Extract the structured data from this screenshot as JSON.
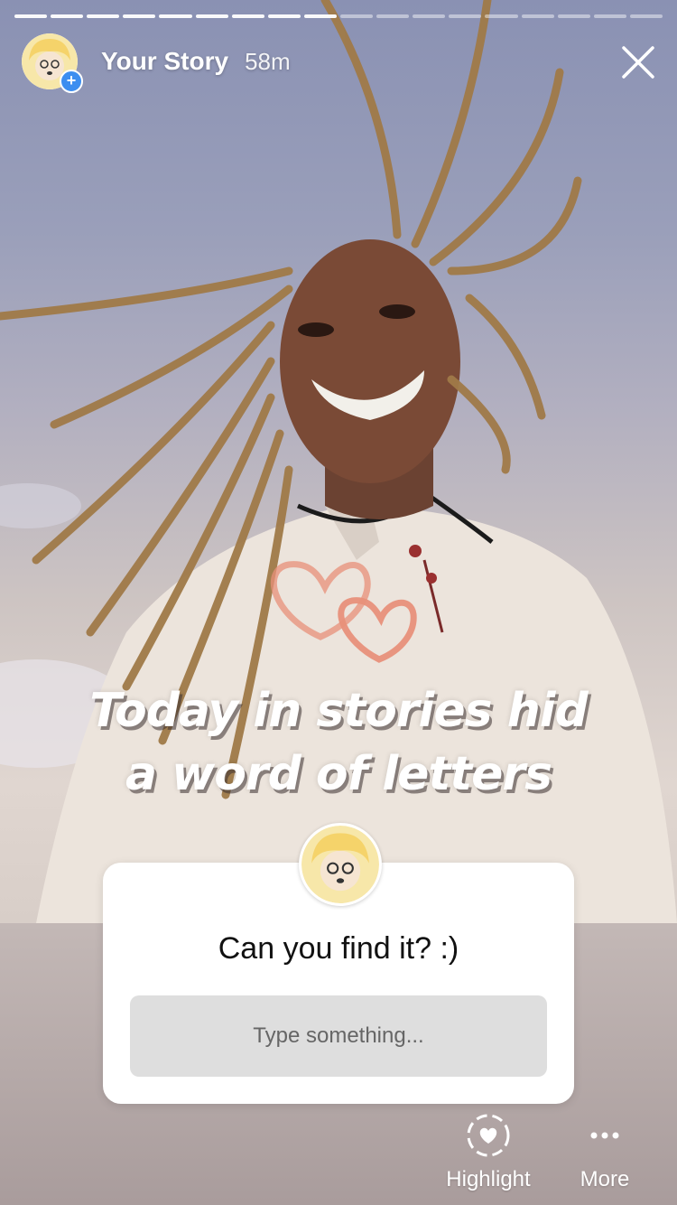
{
  "story": {
    "username": "Your Story",
    "time": "58m",
    "progress_total": 18,
    "progress_completed": 9,
    "close_icon": "close-icon"
  },
  "overlay": {
    "caption_line1": "Today in stories hid",
    "caption_line2": "a word of letters"
  },
  "question_card": {
    "question": "Can you find it? :)",
    "input_placeholder": "Type something..."
  },
  "actions": {
    "highlight_label": "Highlight",
    "more_label": "More"
  },
  "colors": {
    "badge": "#3d8ef0",
    "hearts": "#e8907a"
  }
}
